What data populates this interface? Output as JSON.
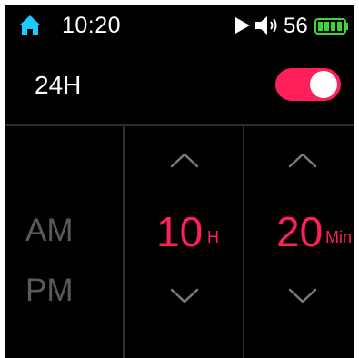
{
  "status_bar": {
    "time": "10:20",
    "volume": "56",
    "icons": {
      "home": "home-icon",
      "play": "play-icon",
      "speaker": "speaker-icon",
      "battery": "battery-icon"
    },
    "home_color": "#1ec8ff",
    "battery_color": "#3cd63c"
  },
  "settings": {
    "label_24h": "24H",
    "toggle_24h_on": true,
    "accent_color": "#ff1f5a"
  },
  "time_picker": {
    "am_label": "AM",
    "pm_label": "PM",
    "hour_value": "10",
    "hour_unit": "H",
    "minute_value": "20",
    "minute_unit": "Min"
  }
}
